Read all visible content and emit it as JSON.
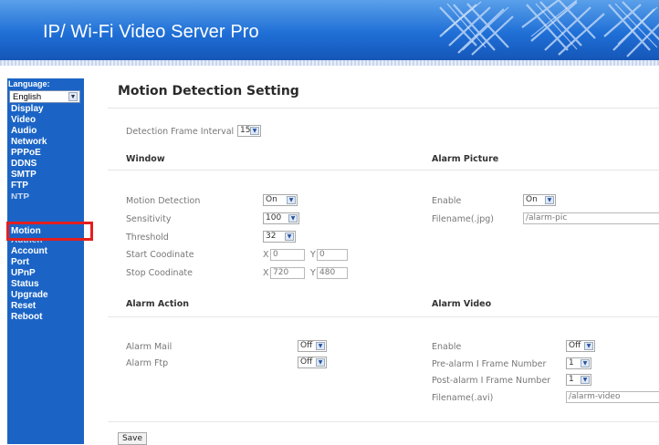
{
  "app": {
    "title": "IP/ Wi-Fi Video Server Pro"
  },
  "sidebar": {
    "language_label": "Language:",
    "language_value": "English",
    "items": [
      {
        "label": "Display"
      },
      {
        "label": "Video"
      },
      {
        "label": "Audio"
      },
      {
        "label": "Network"
      },
      {
        "label": "PPPoE"
      },
      {
        "label": "DDNS"
      },
      {
        "label": "SMTP"
      },
      {
        "label": "FTP"
      },
      {
        "label": "NTP"
      },
      {
        "label": "Motion"
      },
      {
        "label": "Authen"
      },
      {
        "label": "Account"
      },
      {
        "label": "Port"
      },
      {
        "label": "UPnP"
      },
      {
        "label": "Status"
      },
      {
        "label": "Upgrade"
      },
      {
        "label": "Reset"
      },
      {
        "label": "Reboot"
      }
    ],
    "selected": "Motion",
    "highlight_color": "#e31f1f"
  },
  "main": {
    "title": "Motion Detection Setting",
    "detection_interval": {
      "label": "Detection Frame Interval",
      "value": "15"
    },
    "window": {
      "header": "Window",
      "motion_detection": {
        "label": "Motion Detection",
        "value": "On"
      },
      "sensitivity": {
        "label": "Sensitivity",
        "value": "100"
      },
      "threshold": {
        "label": "Threshold",
        "value": "32"
      },
      "start": {
        "label": "Start Coodinate",
        "x_label": "X",
        "x": "0",
        "y_label": "Y",
        "y": "0"
      },
      "stop": {
        "label": "Stop Coodinate",
        "x_label": "X",
        "x": "720",
        "y_label": "Y",
        "y": "480"
      }
    },
    "alarm_picture": {
      "header": "Alarm Picture",
      "enable": {
        "label": "Enable",
        "value": "On"
      },
      "filename": {
        "label": "Filename(.jpg)",
        "value": "/alarm-pic"
      }
    },
    "alarm_action": {
      "header": "Alarm Action",
      "mail": {
        "label": "Alarm Mail",
        "value": "Off"
      },
      "ftp": {
        "label": "Alarm Ftp",
        "value": "Off"
      }
    },
    "alarm_video": {
      "header": "Alarm Video",
      "enable": {
        "label": "Enable",
        "value": "Off"
      },
      "pre": {
        "label": "Pre-alarm I Frame Number",
        "value": "1"
      },
      "post": {
        "label": "Post-alarm I Frame Number",
        "value": "1"
      },
      "filename": {
        "label": "Filename(.avi)",
        "value": "/alarm-video"
      }
    },
    "save_label": "Save"
  },
  "icons": {
    "dropdown": "chevron-down-icon",
    "banner_logo": "lattice-logo-icon"
  },
  "colors": {
    "banner": "#1f6fd6",
    "sidebar": "#1b64c6",
    "highlight": "#e31f1f"
  }
}
